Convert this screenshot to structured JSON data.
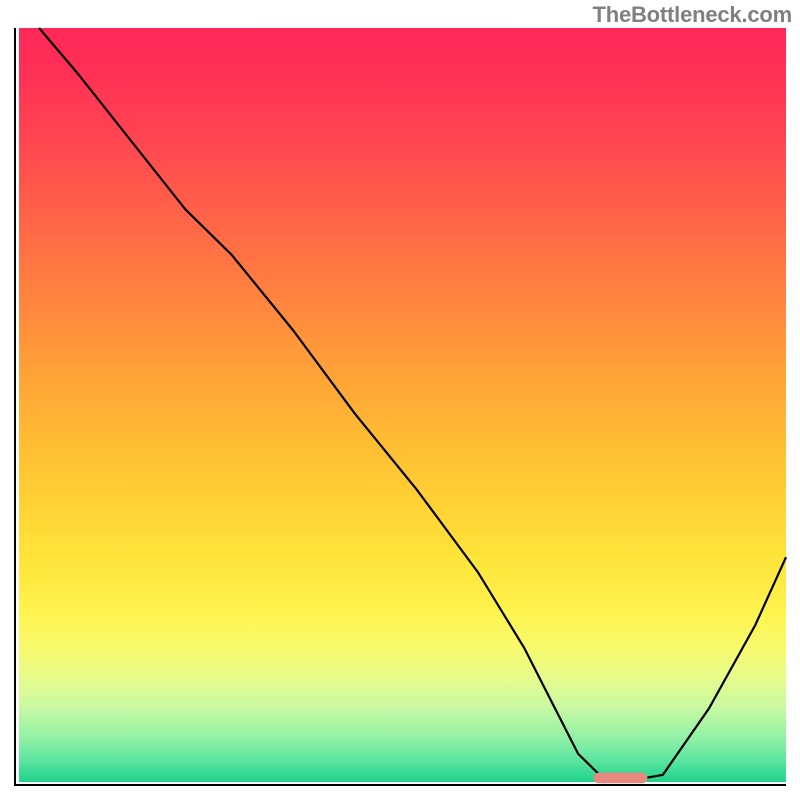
{
  "watermark": "TheBottleneck.com",
  "chart_data": {
    "type": "line",
    "xlim": [
      0,
      100
    ],
    "ylim": [
      0,
      100
    ],
    "title": "",
    "xlabel": "",
    "ylabel": "",
    "series": [
      {
        "name": "bottleneck-curve",
        "x": [
          3,
          8,
          15,
          22,
          28,
          36,
          44,
          52,
          60,
          66,
          70,
          73,
          76,
          80,
          84,
          90,
          96,
          100
        ],
        "values": [
          100,
          94,
          85,
          76,
          70,
          60,
          49,
          39,
          28,
          18,
          10,
          4,
          1,
          0.5,
          1.2,
          10,
          21,
          30
        ]
      }
    ],
    "marker": {
      "x_start": 75,
      "x_end": 82,
      "y": 0.8,
      "color": "#e8877e"
    }
  },
  "colors": {
    "axis": "#000000",
    "curve": "#000000",
    "marker": "#e8877e"
  }
}
